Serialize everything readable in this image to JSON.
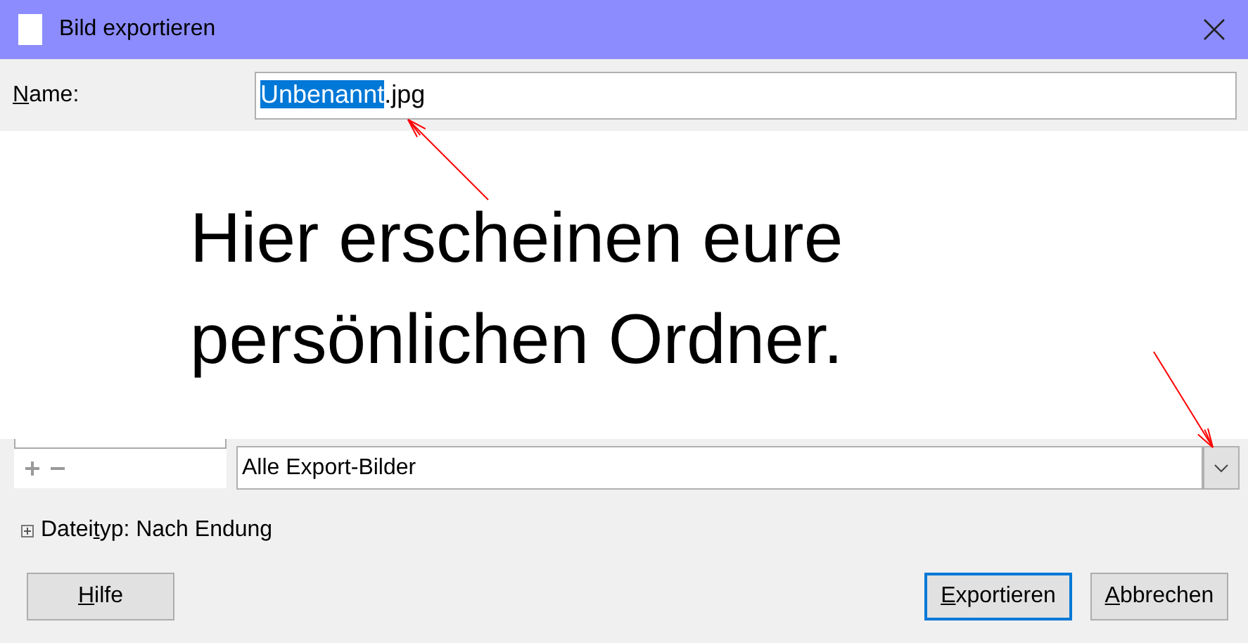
{
  "window": {
    "title": "Bild exportieren"
  },
  "name_field": {
    "label": {
      "key": "N",
      "after": "ame:"
    },
    "selected_text": "Unbenannt",
    "rest_text": ".jpg"
  },
  "annotation": {
    "lines": [
      "Hier erscheinen eure",
      "persönlichen Ordner."
    ]
  },
  "filter": {
    "value": "Alle Export-Bilder"
  },
  "file_type": {
    "expanded": false,
    "label": {
      "before": "Datei",
      "key": "t",
      "after": "yp: Nach Endung"
    }
  },
  "buttons": [
    {
      "kind": "help",
      "label": {
        "key": "H",
        "after": "ilfe"
      },
      "default": false
    },
    {
      "kind": "primary",
      "label": {
        "key": "E",
        "after": "xportieren"
      },
      "default": true
    },
    {
      "kind": "cancel",
      "label": {
        "key": "A",
        "after": "bbrechen"
      },
      "default": false
    }
  ]
}
